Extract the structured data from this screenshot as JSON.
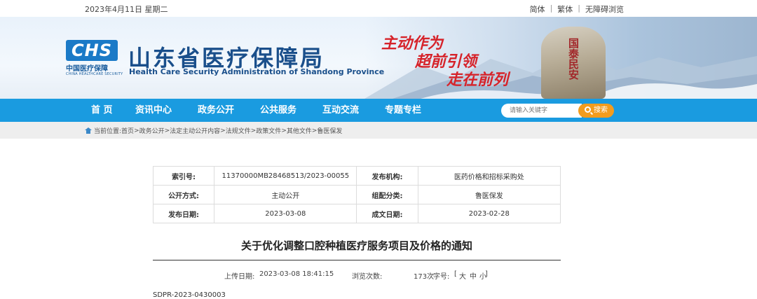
{
  "topbar": {
    "date": "2023年4月11日 星期二",
    "links": [
      "简体",
      "繁体",
      "无障碍浏览"
    ]
  },
  "header": {
    "logo_mark": "CHS",
    "logo_cn": "中国医疗保障",
    "logo_en": "CHINA HEALTHCARE SECURITY",
    "title": "山东省医疗保障局",
    "subtitle": "Health Care Security Administration of Shandong Province",
    "slogan": [
      "主动作为",
      "超前引领",
      "走在前列"
    ],
    "stone_text": "国泰民安"
  },
  "nav": {
    "items": [
      "首 页",
      "资讯中心",
      "政务公开",
      "公共服务",
      "互动交流",
      "专题专栏"
    ],
    "search_placeholder": "请输入关键字",
    "search_button": "搜索"
  },
  "breadcrumb": {
    "label": "当前位置:",
    "items": [
      "首页",
      "政务公开",
      "法定主动公开内容",
      "法规文件",
      "政策文件",
      "其他文件",
      "鲁医保发"
    ],
    "separator": ">"
  },
  "info": {
    "index_label": "索引号:",
    "index_value": "11370000MB28468513/2023-00055",
    "publisher_label": "发布机构:",
    "publisher_value": "医药价格和招标采购处",
    "mode_label": "公开方式:",
    "mode_value": "主动公开",
    "category_label": "组配分类:",
    "category_value": "鲁医保发",
    "pub_date_label": "发布日期:",
    "pub_date_value": "2023-03-08",
    "made_date_label": "成文日期:",
    "made_date_value": "2023-02-28"
  },
  "article": {
    "title": "关于优化调整口腔种植医疗服务项目及价格的通知",
    "upload_label": "上传日期:",
    "upload_value": "2023-03-08 18:41:15",
    "views_label": "浏览次数:",
    "views_value": "173次",
    "fontsize_label": "字号:",
    "fontsize_options": [
      "大",
      "中",
      "小"
    ],
    "doc_code": "SDPR-2023-0430003"
  },
  "colors": {
    "nav_bg": "#1a9be0",
    "search_btn": "#f39c1d",
    "title_blue": "#1a4f8b",
    "slogan_red": "#d6232a"
  }
}
